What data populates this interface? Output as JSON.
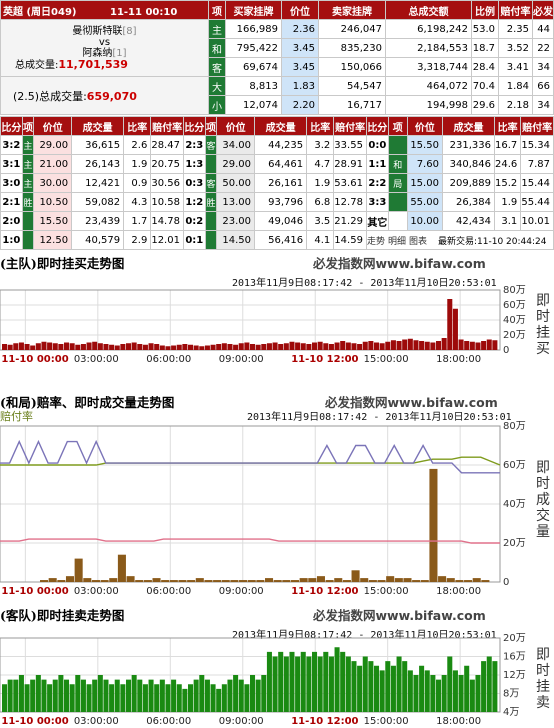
{
  "match": {
    "league": "英超",
    "round": "(周日049)",
    "datetime": "11-11 00:10",
    "home": "曼彻斯特联",
    "home_rank": "[8]",
    "vs": "vs",
    "away": "阿森纳",
    "away_rank": "[1]",
    "total_label": "总成交量:",
    "total_value": "11,701,539",
    "handicap_label": "(2.5)总成交量:",
    "handicap_value": "659,070"
  },
  "main_headers": [
    "项",
    "买家挂牌",
    "价位",
    "卖家挂牌",
    "总成交额",
    "比例",
    "赔付率",
    "必发"
  ],
  "main_rows": [
    {
      "tag": "主",
      "buy": "166,989",
      "price": "2.36",
      "sell": "246,047",
      "amount": "6,198,242",
      "ratio": "53.0",
      "pay": "2.35",
      "idx": "44"
    },
    {
      "tag": "和",
      "buy": "795,422",
      "price": "3.45",
      "sell": "835,230",
      "amount": "2,184,553",
      "ratio": "18.7",
      "pay": "3.52",
      "idx": "22"
    },
    {
      "tag": "客",
      "buy": "69,674",
      "price": "3.45",
      "sell": "150,066",
      "amount": "3,318,744",
      "ratio": "28.4",
      "pay": "3.41",
      "idx": "34"
    },
    {
      "tag": "大",
      "buy": "8,813",
      "price": "1.83",
      "sell": "54,547",
      "amount": "464,072",
      "ratio": "70.4",
      "pay": "1.84",
      "idx": "66"
    },
    {
      "tag": "小",
      "buy": "12,074",
      "price": "2.20",
      "sell": "16,717",
      "amount": "194,998",
      "ratio": "29.6",
      "pay": "2.18",
      "idx": "34"
    }
  ],
  "score_headers": [
    "比分",
    "项",
    "价位",
    "成交量",
    "比率",
    "赔付率"
  ],
  "score_groups": [
    {
      "rows": [
        {
          "score": "3:2",
          "price": "29.00",
          "vol": "36,615",
          "ratio": "2.6",
          "pay": "28.47"
        },
        {
          "score": "3:1",
          "price": "21.00",
          "vol": "26,143",
          "ratio": "1.9",
          "pay": "20.75"
        },
        {
          "score": "3:0",
          "price": "30.00",
          "vol": "12,421",
          "ratio": "0.9",
          "pay": "30.56"
        },
        {
          "score": "2:1",
          "price": "10.50",
          "vol": "59,082",
          "ratio": "4.3",
          "pay": "10.58"
        },
        {
          "score": "2:0",
          "price": "15.50",
          "vol": "23,439",
          "ratio": "1.7",
          "pay": "14.78"
        },
        {
          "score": "1:0",
          "price": "12.50",
          "vol": "40,579",
          "ratio": "2.9",
          "pay": "12.01"
        }
      ],
      "side": [
        "主",
        "主",
        "主",
        "胜",
        "",
        ""
      ]
    },
    {
      "rows": [
        {
          "score": "2:3",
          "price": "34.00",
          "vol": "44,235",
          "ratio": "3.2",
          "pay": "33.55"
        },
        {
          "score": "1:3",
          "price": "29.00",
          "vol": "64,461",
          "ratio": "4.7",
          "pay": "28.91"
        },
        {
          "score": "0:3",
          "price": "50.00",
          "vol": "26,161",
          "ratio": "1.9",
          "pay": "53.61"
        },
        {
          "score": "1:2",
          "price": "13.00",
          "vol": "93,796",
          "ratio": "6.8",
          "pay": "12.78"
        },
        {
          "score": "0:2",
          "price": "23.00",
          "vol": "49,046",
          "ratio": "3.5",
          "pay": "21.29"
        },
        {
          "score": "0:1",
          "price": "14.50",
          "vol": "56,416",
          "ratio": "4.1",
          "pay": "14.59"
        }
      ],
      "side": [
        "客",
        "",
        "客",
        "胜",
        "",
        ""
      ]
    },
    {
      "rows": [
        {
          "score": "0:0",
          "price": "15.50",
          "vol": "231,336",
          "ratio": "16.7",
          "pay": "15.34"
        },
        {
          "score": "1:1",
          "price": "7.60",
          "vol": "340,846",
          "ratio": "24.6",
          "pay": "7.87"
        },
        {
          "score": "2:2",
          "price": "15.00",
          "vol": "209,889",
          "ratio": "15.2",
          "pay": "15.44"
        },
        {
          "score": "3:3",
          "price": "55.00",
          "vol": "26,384",
          "ratio": "1.9",
          "pay": "55.44"
        },
        {
          "score": "其它",
          "price": "10.00",
          "vol": "42,434",
          "ratio": "3.1",
          "pay": "10.01"
        }
      ],
      "side": [
        "",
        "和",
        "局",
        "",
        "其它"
      ]
    }
  ],
  "footer_links": [
    "走势",
    "明细",
    "图表"
  ],
  "last_trade": "最新交易:11-10 20:44:24",
  "charts": [
    {
      "title": "(主队)即时挂买走势图",
      "brand": "必发指数网www.bifaw.com",
      "range": "2013年11月9日08:17:42 - 2013年11月10日20:53:01",
      "vlabel": "即时挂买",
      "y_ticks": [
        "80万",
        "60万",
        "40万",
        "20万",
        "0"
      ],
      "x_ticks": [
        "11-10 00:00",
        "03:00:00",
        "06:00:00",
        "09:00:00",
        "11-10 12:00",
        "15:00:00",
        "18:00:00"
      ],
      "color": "#9d0a0a"
    },
    {
      "title": "(和局)赔率、即时成交量走势图",
      "brand": "必发指数网www.bifaw.com",
      "range": "2013年11月9日08:17:42 - 2013年11月10日20:53:01",
      "vlabel": "即时成交量",
      "y_ticks": [
        "80万",
        "60万",
        "40万",
        "20万",
        "0"
      ],
      "x_ticks": [
        "11-10 00:00",
        "03:00:00",
        "06:00:00",
        "09:00:00",
        "11-10 12:00",
        "15:00:00",
        "18:00:00"
      ],
      "left_label": "赔付率",
      "color": "#8a5a1a"
    },
    {
      "title": "(客队)即时挂卖走势图",
      "brand": "必发指数网www.bifaw.com",
      "range": "2013年11月9日08:17:42 - 2013年11月10日20:53:01",
      "vlabel": "即时挂卖",
      "y_ticks": [
        "20万",
        "16万",
        "12万",
        "8万",
        "4万"
      ],
      "x_ticks": [
        "11-10 00:00",
        "03:00:00",
        "06:00:00",
        "09:00:00",
        "11-10 12:00",
        "15:00:00",
        "18:00:00"
      ],
      "color": "#1a8a12"
    }
  ],
  "chart_data": [
    {
      "type": "bar",
      "title": "(主队)即时挂买走势图",
      "unit": "万",
      "ylim": [
        0,
        80
      ],
      "values": [
        8,
        7,
        9,
        10,
        8,
        6,
        9,
        11,
        10,
        9,
        8,
        10,
        9,
        7,
        8,
        10,
        11,
        9,
        8,
        7,
        6,
        8,
        9,
        10,
        8,
        7,
        9,
        8,
        6,
        5,
        6,
        7,
        8,
        7,
        6,
        5,
        6,
        7,
        8,
        9,
        8,
        7,
        9,
        10,
        8,
        7,
        8,
        9,
        10,
        8,
        9,
        11,
        10,
        9,
        8,
        10,
        11,
        9,
        8,
        10,
        12,
        10,
        9,
        8,
        11,
        12,
        10,
        9,
        11,
        13,
        12,
        14,
        15,
        13,
        12,
        11,
        10,
        12,
        16,
        68,
        55,
        14,
        12,
        11,
        10,
        12,
        14,
        13
      ]
    },
    {
      "type": "line",
      "title": "(和局)赔率、即时成交量走势图",
      "unit": "万",
      "ylim": [
        0,
        80
      ],
      "series": [
        {
          "name": "olive",
          "values": [
            60,
            60,
            60,
            60,
            60,
            60,
            60,
            60,
            60,
            60,
            60,
            61,
            61,
            61,
            61,
            61,
            61,
            61,
            61,
            61,
            61,
            61,
            61,
            61,
            61,
            61,
            61,
            61,
            61,
            61,
            61,
            61,
            61,
            61,
            61,
            61,
            61,
            61,
            61,
            61,
            61,
            61,
            61,
            61,
            62,
            63,
            63,
            63,
            64,
            64,
            64,
            62,
            60
          ]
        },
        {
          "name": "purple",
          "values": [
            61,
            61,
            72,
            61,
            72,
            61,
            61,
            72,
            72,
            61,
            72,
            61,
            61,
            61,
            61,
            61,
            61,
            61,
            61,
            61,
            61,
            61,
            61,
            61,
            61,
            61,
            61,
            61,
            61,
            61,
            61,
            61,
            61,
            61,
            70,
            61,
            61,
            70,
            70,
            61,
            61,
            70,
            61,
            61,
            70,
            61,
            61,
            61,
            56,
            56,
            56,
            56,
            56
          ]
        },
        {
          "name": "pink",
          "values": [
            21,
            21,
            21,
            22,
            22,
            22,
            22,
            22,
            22,
            22,
            22,
            21,
            21,
            21,
            21,
            21,
            21,
            22,
            22,
            22,
            22,
            22,
            22,
            22,
            22,
            22,
            22,
            22,
            22,
            21,
            21,
            21,
            21,
            21,
            21,
            21,
            21,
            21,
            21,
            21,
            21,
            21,
            21,
            21,
            21,
            21,
            21,
            21,
            21,
            20,
            20,
            20,
            20
          ]
        }
      ],
      "volume": [
        1,
        2,
        1,
        3,
        12,
        2,
        1,
        1,
        2,
        14,
        3,
        1,
        1,
        2,
        1,
        1,
        1,
        1,
        2,
        1,
        1,
        1,
        1,
        1,
        1,
        1,
        2,
        1,
        1,
        1,
        2,
        2,
        3,
        1,
        2,
        1,
        6,
        2,
        1,
        1,
        3,
        2,
        2,
        1,
        1,
        58,
        3,
        2,
        1,
        1,
        2,
        1
      ]
    },
    {
      "type": "bar",
      "title": "(客队)即时挂卖走势图",
      "unit": "万",
      "ylim": [
        4,
        20
      ],
      "values": [
        10,
        11,
        11,
        12,
        10,
        11,
        12,
        11,
        10,
        11,
        12,
        11,
        10,
        12,
        11,
        10,
        11,
        12,
        11,
        10,
        11,
        10,
        11,
        12,
        11,
        10,
        11,
        10,
        11,
        10,
        11,
        10,
        9,
        10,
        11,
        12,
        11,
        10,
        9,
        10,
        11,
        12,
        11,
        10,
        12,
        11,
        12,
        17,
        16,
        17,
        16,
        17,
        16,
        17,
        16,
        17,
        16,
        17,
        16,
        18,
        17,
        16,
        15,
        14,
        16,
        15,
        14,
        13,
        15,
        14,
        16,
        15,
        13,
        12,
        14,
        13,
        12,
        11,
        12,
        16,
        13,
        12,
        14,
        11,
        12,
        15,
        16,
        15
      ]
    }
  ]
}
